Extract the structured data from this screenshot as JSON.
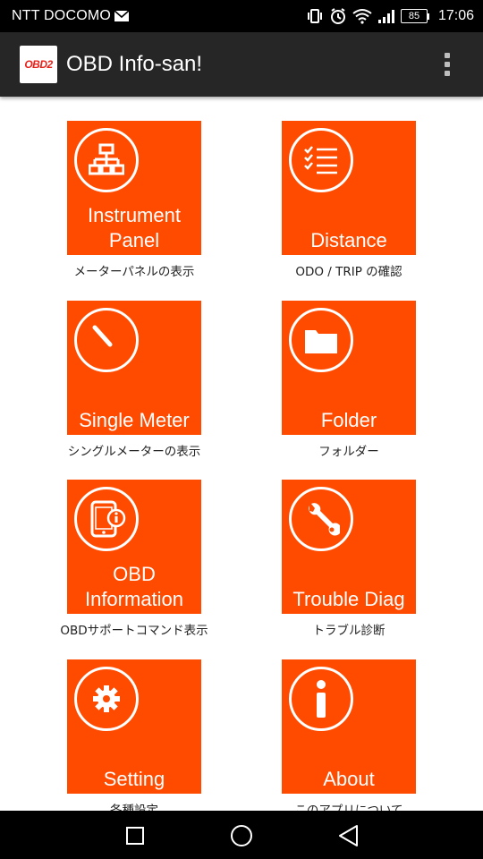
{
  "status_bar": {
    "carrier": "NTT DOCOMO",
    "battery": "85",
    "time": "17:06"
  },
  "app_bar": {
    "logo_text": "OBD2",
    "title": "OBD Info-san!"
  },
  "tiles": [
    {
      "label": "Instrument\nPanel",
      "caption": "メーターパネルの表示",
      "icon": "network-diagram-icon"
    },
    {
      "label": "Distance",
      "caption": "ODO / TRIP の確認",
      "icon": "checklist-icon"
    },
    {
      "label": "Single Meter",
      "caption": "シングルメーターの表示",
      "icon": "gauge-needle-icon"
    },
    {
      "label": "Folder",
      "caption": "フォルダー",
      "icon": "folder-icon"
    },
    {
      "label": "OBD\nInformation",
      "caption": "OBDサポートコマンド表示",
      "icon": "phone-info-icon"
    },
    {
      "label": "Trouble Diag",
      "caption": "トラブル診断",
      "icon": "wrench-icon"
    },
    {
      "label": "Setting",
      "caption": "各種設定",
      "icon": "gear-icon"
    },
    {
      "label": "About",
      "caption": "このアプリについて",
      "icon": "info-icon"
    }
  ],
  "colors": {
    "tile": "#ff4b00",
    "app_bar": "#262626",
    "status_bar": "#000000"
  }
}
